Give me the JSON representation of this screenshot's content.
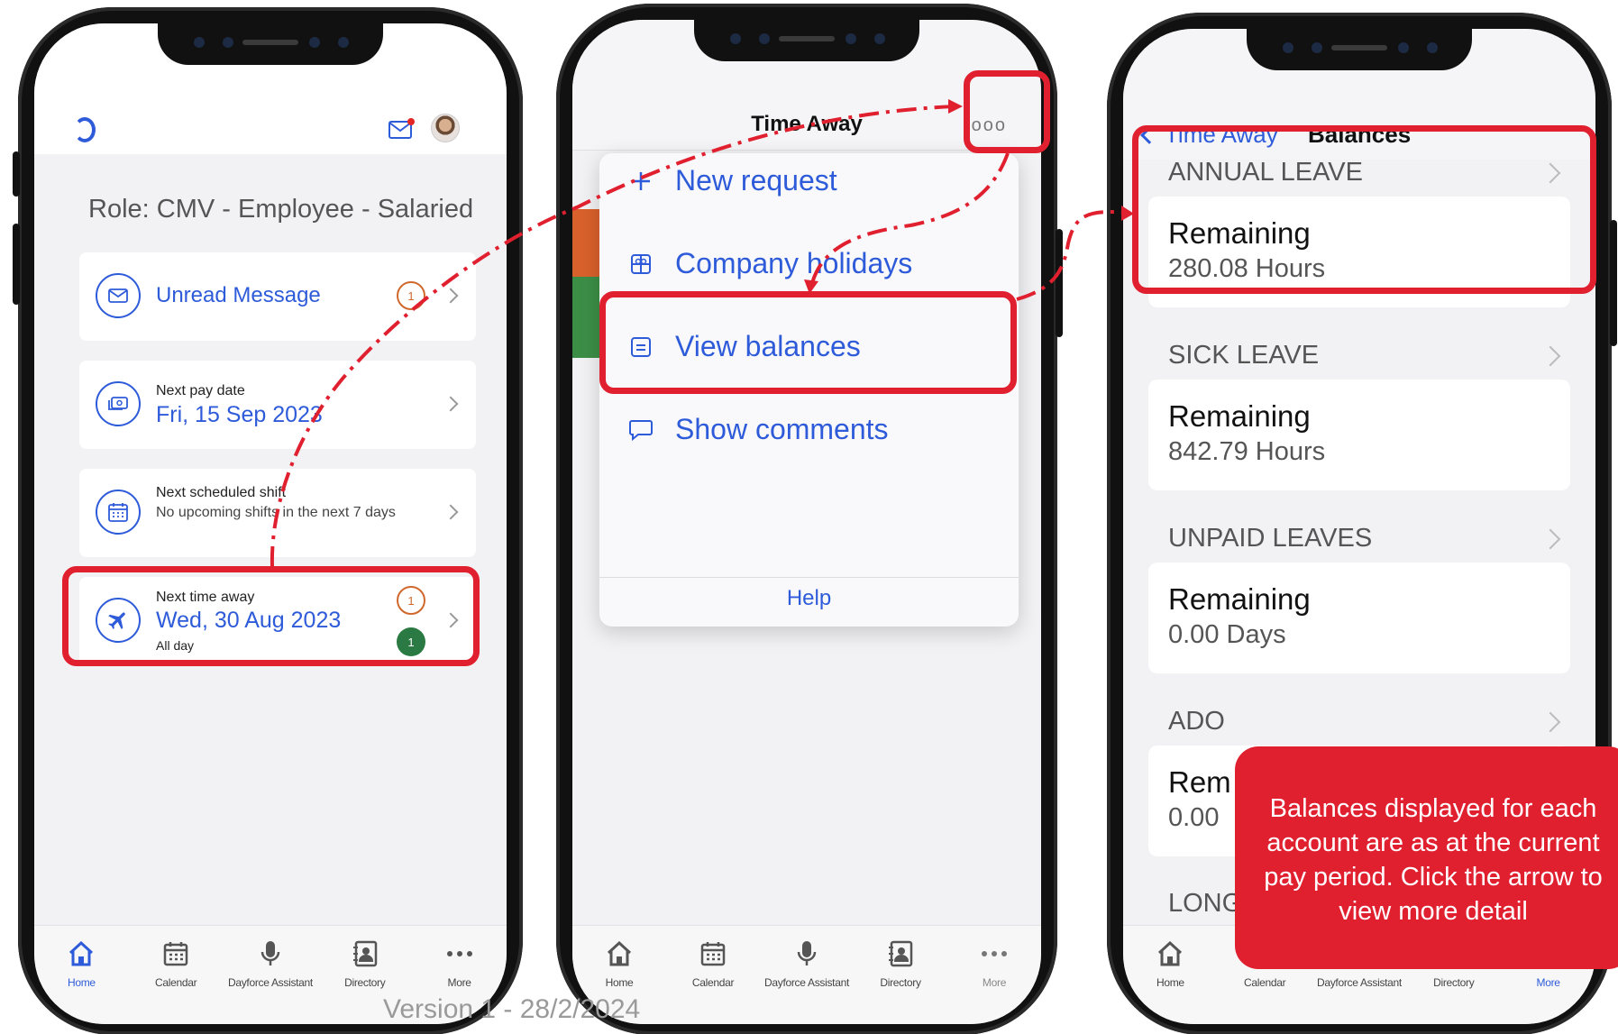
{
  "phone1": {
    "role": "Role: CMV - Employee - Salaried",
    "cards": {
      "unread": {
        "label": "Unread Message",
        "badge": "1"
      },
      "pay": {
        "label": "Next pay date",
        "value": "Fri, 15 Sep 2023"
      },
      "shift": {
        "label": "Next scheduled shift",
        "value": "No upcoming shifts in the next 7 days"
      },
      "away": {
        "label": "Next time away",
        "value": "Wed, 30 Aug 2023",
        "sub": "All day",
        "badge1": "1",
        "badge2": "1"
      }
    }
  },
  "phone2": {
    "title": "Time Away",
    "more": "ooo",
    "menu": [
      "New request",
      "Company holidays",
      "View balances",
      "Show comments"
    ],
    "help": "Help"
  },
  "phone3": {
    "back": "Time Away",
    "title": "Balances",
    "sections": [
      {
        "name": "ANNUAL LEAVE",
        "label": "Remaining",
        "value": "280.08 Hours"
      },
      {
        "name": "SICK LEAVE",
        "label": "Remaining",
        "value": "842.79 Hours"
      },
      {
        "name": "UNPAID LEAVES",
        "label": "Remaining",
        "value": "0.00 Days"
      },
      {
        "name": "ADO",
        "label": "Rem",
        "value": "0.00"
      },
      {
        "name": "LONG"
      }
    ]
  },
  "tabs": [
    "Home",
    "Calendar",
    "Dayforce Assistant",
    "Directory",
    "More"
  ],
  "callout": "Balances displayed for each account are as at the current pay period. Click the arrow to view more detail",
  "version": "Version 1 - 28/2/2024",
  "colors": {
    "accent": "#2e5bd9",
    "highlight": "#e01f2f",
    "orange": "#d0682d",
    "green": "#2c7a43"
  }
}
